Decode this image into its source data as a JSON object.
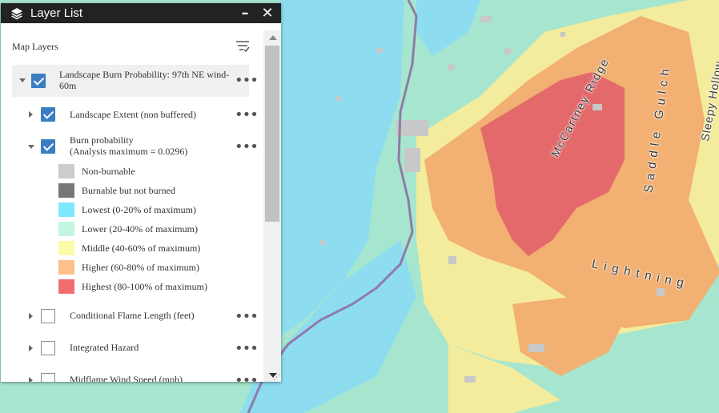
{
  "widget": {
    "title": "Layer List",
    "icon": "layers-icon",
    "minimize_label": "–",
    "close_label": "✕"
  },
  "header": {
    "label": "Map Layers",
    "filter_icon": "filter-icon"
  },
  "layers": {
    "top": {
      "label_line1": "Landscape Burn Probability: 97th NE wind-",
      "label_line2": "60m",
      "checked": true,
      "expanded": true
    },
    "extent": {
      "label": "Landscape Extent (non buffered)",
      "checked": true,
      "expanded": false
    },
    "burn": {
      "label_line1": "Burn probability",
      "label_line2": "(Analysis maximum = 0.0296)",
      "checked": true,
      "expanded": true
    },
    "flame": {
      "label": "Conditional Flame Length (feet)",
      "checked": false,
      "expanded": false
    },
    "hazard": {
      "label": "Integrated Hazard",
      "checked": false,
      "expanded": false
    },
    "wind": {
      "label": "Midflame Wind Speed (mph)",
      "checked": false,
      "expanded": false
    },
    "options_icon": "•••"
  },
  "legend": [
    {
      "label": "Non-burnable",
      "color": "#cccccc"
    },
    {
      "label": "Burnable but not burned",
      "color": "#777777"
    },
    {
      "label": "Lowest (0-20% of maximum)",
      "color": "#7ee8ff"
    },
    {
      "label": "Lower (20-40% of maximum)",
      "color": "#c4f5e0"
    },
    {
      "label": "Middle (40-60% of maximum)",
      "color": "#fffaa8"
    },
    {
      "label": "Higher (60-80% of maximum)",
      "color": "#fdc08a"
    },
    {
      "label": "Highest (80-100% of maximum)",
      "color": "#f06e70"
    }
  ],
  "map": {
    "labels": {
      "mccartney": "McCartney Ridge",
      "saddle": "Saddle Gulch",
      "sleepy": "Sleepy Hollow",
      "lightning": "Lightning"
    },
    "colors": {
      "lowest": "#8edcf0",
      "lower": "#a6e6cf",
      "middle": "#f3ec9c",
      "higher": "#f2b072",
      "highest": "#e4696b",
      "road": "#8f7ba6"
    }
  }
}
